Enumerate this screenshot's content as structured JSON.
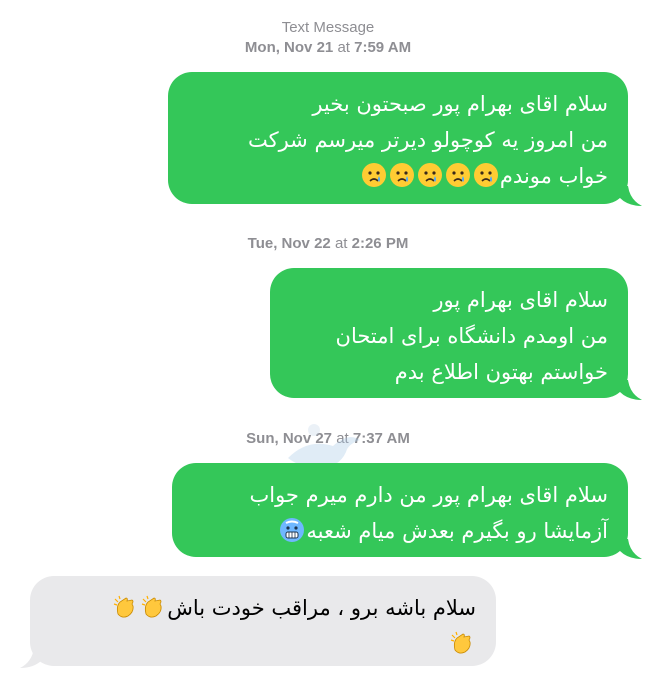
{
  "header": {
    "service": "Text Message",
    "day": "Mon, Nov 21",
    "at": "at",
    "time": "7:59 AM"
  },
  "messages": [
    {
      "id": "m1",
      "direction": "outgoing",
      "lines": [
        "سلام اقای بهرام پور صبحتون بخیر",
        "من امروز یه کوچولو دیرتر میرسم شرکت",
        "خواب موندم"
      ],
      "emoji": [
        "crying-face",
        "crying-face",
        "crying-face",
        "crying-face",
        "crying-face"
      ]
    },
    {
      "id": "m2",
      "direction": "outgoing",
      "timestamp": {
        "day": "Tue, Nov 22",
        "at": "at",
        "time": "2:26 PM"
      },
      "lines": [
        "سلام اقای بهرام پور",
        "من اومدم دانشگاه برای امتحان",
        "خواستم بهتون اطلاع بدم"
      ]
    },
    {
      "id": "m3",
      "direction": "outgoing",
      "timestamp": {
        "day": "Sun, Nov 27",
        "at": "at",
        "time": "7:37 AM"
      },
      "lines": [
        "سلام اقای بهرام پور من دارم میرم جواب",
        "آزمایشا رو بگیرم بعدش میام شعبه"
      ],
      "emoji": [
        "grimacing-cold-face"
      ]
    },
    {
      "id": "m4",
      "direction": "incoming",
      "lines": [
        "سلام باشه برو ، مراقب خودت باش"
      ],
      "emoji": [
        "clapping-hands",
        "clapping-hands",
        "clapping-hands"
      ]
    }
  ],
  "colors": {
    "outgoing_bubble": "#34c759",
    "incoming_bubble": "#e9e9eb",
    "timestamp_text": "#8e8e93"
  }
}
